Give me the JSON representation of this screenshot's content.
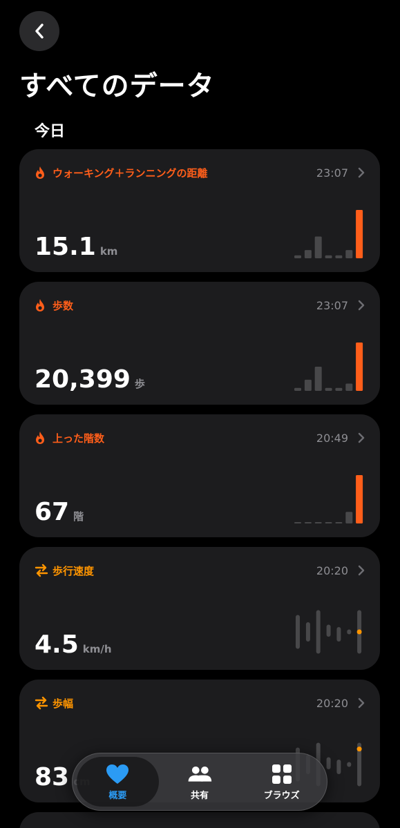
{
  "header": {
    "title": "すべてのデータ",
    "back_icon": "chevron-left-icon"
  },
  "section_title": "今日",
  "colors": {
    "orange": "#FF5E1A",
    "amber": "#FF9500",
    "gray": "#8E8E93",
    "card": "#1C1C1E",
    "blue": "#2B9BF4"
  },
  "cards": [
    {
      "label": "ウォーキング＋ランニングの距離",
      "time": "23:07",
      "value": "15.1",
      "unit": "km",
      "icon": "flame-icon",
      "chart": "bars",
      "bars": [
        0.06,
        0.17,
        0.45,
        0.06,
        0.06,
        0.17,
        1.0
      ]
    },
    {
      "label": "歩数",
      "time": "23:07",
      "value": "20,399",
      "unit": "歩",
      "icon": "flame-icon",
      "chart": "bars",
      "bars": [
        0.06,
        0.23,
        0.5,
        0.06,
        0.06,
        0.15,
        1.0
      ]
    },
    {
      "label": "上った階数",
      "time": "20:49",
      "value": "67",
      "unit": "階",
      "icon": "flame-icon",
      "chart": "bars",
      "bars": [
        0.02,
        0.02,
        0.02,
        0.02,
        0.02,
        0.24,
        1.0
      ]
    },
    {
      "label": "歩行速度",
      "time": "20:20",
      "value": "4.5",
      "unit": "km/h",
      "icon": "arrows-icon",
      "chart": "ranges",
      "ranges": [
        [
          0.15,
          0.85
        ],
        [
          0.3,
          0.7
        ],
        [
          0.05,
          0.95
        ],
        [
          0.4,
          0.65
        ],
        [
          0.3,
          0.6
        ],
        [
          0.45,
          0.55
        ],
        [
          0.05,
          0.95
        ]
      ],
      "dot": 0.5
    },
    {
      "label": "歩幅",
      "time": "20:20",
      "value": "83",
      "unit": "cm",
      "icon": "arrows-icon",
      "chart": "ranges",
      "ranges": [
        [
          0.15,
          0.85
        ],
        [
          0.3,
          0.7
        ],
        [
          0.05,
          0.95
        ],
        [
          0.4,
          0.65
        ],
        [
          0.3,
          0.6
        ],
        [
          0.45,
          0.55
        ],
        [
          0.05,
          0.95
        ]
      ],
      "dot": 0.18
    }
  ],
  "tabs": [
    {
      "label": "概要",
      "icon": "heart-icon",
      "active": true
    },
    {
      "label": "共有",
      "icon": "people-icon",
      "active": false
    },
    {
      "label": "ブラウズ",
      "icon": "grid-icon",
      "active": false
    }
  ]
}
